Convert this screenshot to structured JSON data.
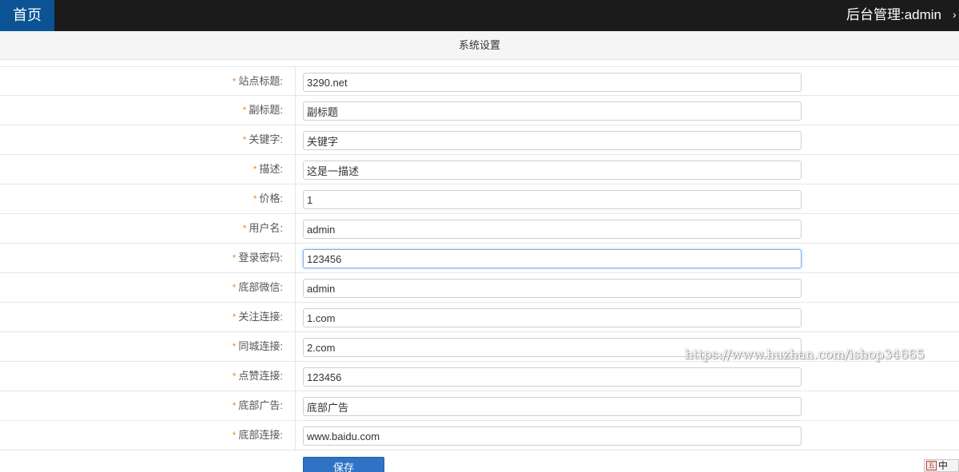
{
  "topbar": {
    "home_label": "首页",
    "admin_title": "后台管理:admin"
  },
  "section": {
    "title": "系统设置"
  },
  "form": {
    "required_mark": "*",
    "fields": [
      {
        "label": "站点标题:",
        "value": "3290.net"
      },
      {
        "label": "副标题:",
        "value": "副标题"
      },
      {
        "label": "关键字:",
        "value": "关键字"
      },
      {
        "label": "描述:",
        "value": "这是一描述"
      },
      {
        "label": "价格:",
        "value": "1"
      },
      {
        "label": "用户名:",
        "value": "admin"
      },
      {
        "label": "登录密码:",
        "value": "123456"
      },
      {
        "label": "底部微信:",
        "value": "admin"
      },
      {
        "label": "关注连接:",
        "value": "1.com"
      },
      {
        "label": "同城连接:",
        "value": "2.com"
      },
      {
        "label": "点赞连接:",
        "value": "123456"
      },
      {
        "label": "底部广告:",
        "value": "底部广告"
      },
      {
        "label": "底部连接:",
        "value": "www.baidu.com"
      }
    ],
    "save_label": "保存"
  },
  "watermark": {
    "text": "https://www.huzhan.com/ishop34665"
  },
  "ime": {
    "icon_label": "五",
    "mode_label": "中",
    "icon": "ime-indicator-icon"
  },
  "colors": {
    "topbar": "#1b1b1b",
    "home_tab": "#0b5394",
    "required": "#f08a2b",
    "save_button": "#2f73c5"
  }
}
